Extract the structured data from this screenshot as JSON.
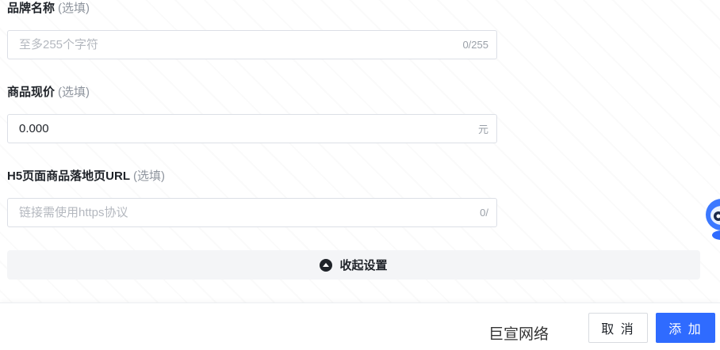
{
  "brand_field": {
    "label": "品牌名称",
    "optional": "(选填)",
    "placeholder": "至多255个字符",
    "value": "",
    "counter": "0/255"
  },
  "price_field": {
    "label": "商品现价",
    "optional": "(选填)",
    "value": "0.000",
    "unit": "元"
  },
  "url_field": {
    "label": "H5页面商品落地页URL",
    "optional": "(选填)",
    "placeholder": "链接需使用https协议",
    "value": "",
    "counter": "0/"
  },
  "collapse": {
    "label": "收起设置",
    "icon": "chevron-up-circle-icon"
  },
  "footer": {
    "brand": "巨宣网络",
    "cancel_label": "取 消",
    "add_label": "添 加"
  },
  "assistant": {
    "icon": "robot-assistant-icon",
    "color": "#2f6bff"
  },
  "colors": {
    "primary": "#2f6bff",
    "border": "#dcdfe6",
    "placeholder": "#b4b8bf"
  }
}
